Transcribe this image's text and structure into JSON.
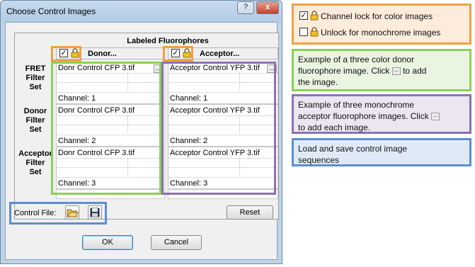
{
  "window": {
    "title": "Choose Control Images",
    "help_label": "?",
    "close_label": "x"
  },
  "grid": {
    "group_title": "Labeled Fluorophores",
    "columns": [
      {
        "label": "Donor...",
        "checked": true
      },
      {
        "label": "Acceptor...",
        "checked": true
      }
    ],
    "rows": [
      {
        "label_lines": [
          "FRET",
          "Filter",
          "Set"
        ],
        "donor": {
          "file": "Donr Control CFP 3.tif",
          "channel": "Channel: 1"
        },
        "acceptor": {
          "file": "Acceptor Control YFP 3.tif",
          "channel": "Channel: 1"
        }
      },
      {
        "label_lines": [
          "Donor",
          "Filter",
          "Set"
        ],
        "donor": {
          "file": "Donr Control CFP 3.tif",
          "channel": "Channel: 2"
        },
        "acceptor": {
          "file": "Acceptor Control YFP 3.tif",
          "channel": "Channel: 2"
        }
      },
      {
        "label_lines": [
          "Acceptor",
          "Filter",
          "Set"
        ],
        "donor": {
          "file": "Donr Control CFP 3.tif",
          "channel": "Channel: 3"
        },
        "acceptor": {
          "file": "Acceptor Control YFP 3.tif",
          "channel": "Channel: 3"
        }
      }
    ],
    "ellipsis_label": "..."
  },
  "control_file": {
    "label": "Control File:",
    "open_icon": "folder-open-icon",
    "save_icon": "floppy-disk-icon",
    "reset_label": "Reset"
  },
  "buttons": {
    "ok": "OK",
    "cancel": "Cancel"
  },
  "legend": {
    "lock_label": "Channel lock for color images",
    "unlock_label": "Unlock for monochrome images"
  },
  "notes": {
    "green": {
      "line1": "Example of a three color donor",
      "line2a": "fluorophore image. Click",
      "line2b": "to add",
      "line3": "the image."
    },
    "purple": {
      "line1": "Example of three monochrome",
      "line2": "acceptor fluorophore images. Click",
      "line3": "to add each image."
    },
    "blue": {
      "line1": "Load and save control image",
      "line2": "sequences"
    }
  },
  "colors": {
    "orange": "#f2a041",
    "green": "#8ccf59",
    "purple": "#8a72b0",
    "blue": "#5b8fd0"
  }
}
